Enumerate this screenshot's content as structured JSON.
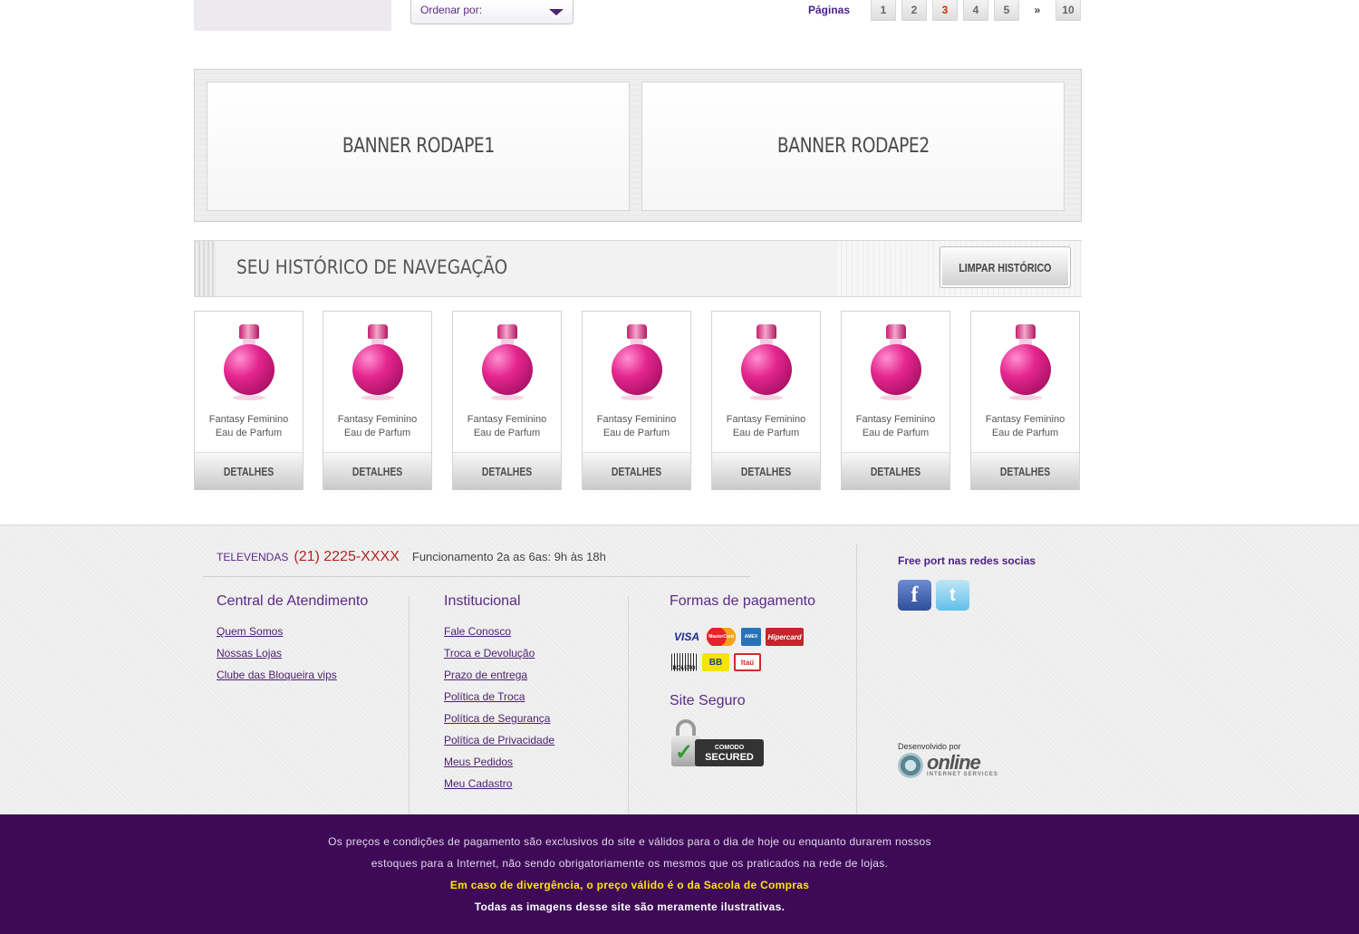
{
  "toolbar": {
    "sort_label": "Ordenar por:",
    "pages_label": "Páginas",
    "pages": [
      "1",
      "2",
      "3",
      "4",
      "5",
      "»",
      "10"
    ],
    "current_page": "3"
  },
  "banners": [
    "BANNER RODAPE1",
    "BANNER RODAPE2"
  ],
  "history": {
    "title": "SEU HISTÓRICO DE NAVEGAÇÃO",
    "clear_button": "LIMPAR HISTÓRICO"
  },
  "products": [
    {
      "name_line1": "Fantasy Feminino",
      "name_line2": "Eau de Parfum",
      "button": "DETALHES"
    },
    {
      "name_line1": "Fantasy Feminino",
      "name_line2": "Eau de Parfum",
      "button": "DETALHES"
    },
    {
      "name_line1": "Fantasy Feminino",
      "name_line2": "Eau de Parfum",
      "button": "DETALHES"
    },
    {
      "name_line1": "Fantasy Feminino",
      "name_line2": "Eau de Parfum",
      "button": "DETALHES"
    },
    {
      "name_line1": "Fantasy Feminino",
      "name_line2": "Eau de Parfum",
      "button": "DETALHES"
    },
    {
      "name_line1": "Fantasy Feminino",
      "name_line2": "Eau de Parfum",
      "button": "DETALHES"
    },
    {
      "name_line1": "Fantasy Feminino",
      "name_line2": "Eau de Parfum",
      "button": "DETALHES"
    }
  ],
  "footer": {
    "televendas_label": "TELEVENDAS",
    "televendas_phone": "(21) 2225-XXXX",
    "hours": "Funcionamento 2a as 6as: 9h às 18h",
    "central": {
      "title": "Central de Atendimento",
      "links": [
        "Quem Somos",
        "Nossas Lojas",
        "Clube das Bloqueira vips"
      ]
    },
    "institucional": {
      "title": "Institucional",
      "links": [
        "Fale Conosco",
        "Troca e Devolução",
        "Prazo de entrega",
        "Política de Troca",
        "Política de Segurança",
        "Política de Privacidade",
        "Meus Pedidos",
        "Meu Cadastro"
      ]
    },
    "payment": {
      "title": "Formas de pagamento",
      "methods": [
        "VISA",
        "MasterCard",
        "AMEX",
        "Hipercard",
        "BOLETO",
        "BB",
        "Itaú"
      ]
    },
    "secure": {
      "title": "Site Seguro",
      "seal_brand": "COMODO",
      "seal_text": "SECURED"
    },
    "social": {
      "title": "Free port nas redes socias",
      "icons": [
        "facebook-icon",
        "twitter-icon"
      ]
    },
    "developer": {
      "label": "Desenvolvido por",
      "brand": "online",
      "tagline": "INTERNET SERVICES"
    }
  },
  "disclaimer": {
    "line1": "Os preços e condições de pagamento são exclusivos do site e válidos para o dia de hoje ou enquanto durarem nossos",
    "line2": "estoques para a Internet, não sendo obrigatoriamente os mesmos que os praticados na rede de lojas.",
    "line3": "Em caso de divergência, o preço válido é o da Sacola de Compras",
    "line4": "Todas as imagens desse site são meramente ilustrativas."
  },
  "colors": {
    "brand_purple": "#5b2a86",
    "footer_bottom": "#3e0a58",
    "highlight_yellow": "#ffe600",
    "phone_red": "#b32424"
  }
}
